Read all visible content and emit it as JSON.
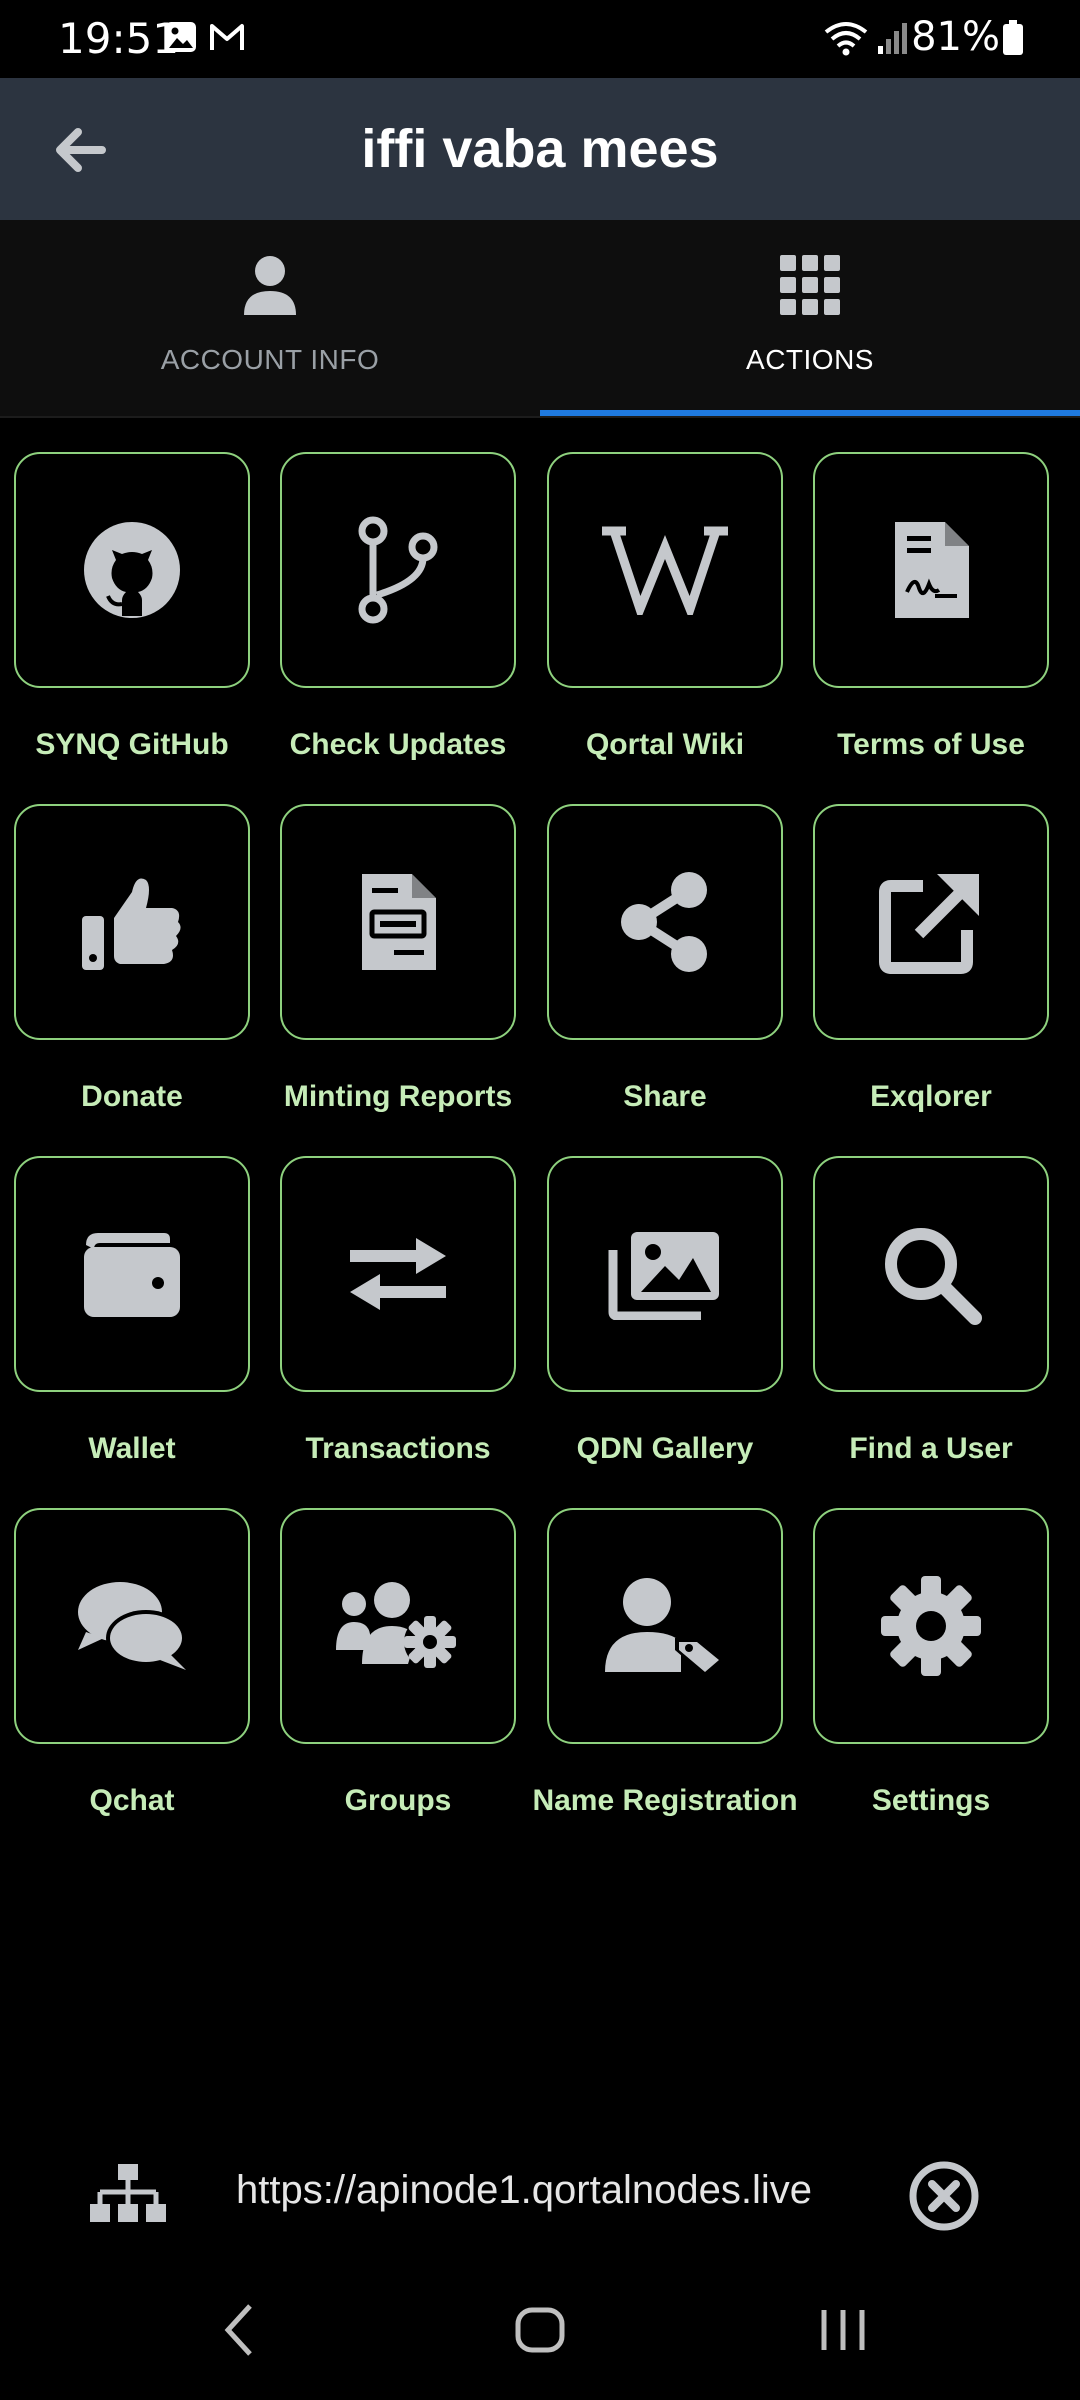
{
  "status_bar": {
    "time": "19:51",
    "battery": "81%"
  },
  "header": {
    "title": "iffi vaba mees",
    "back_icon": "arrow-left-icon"
  },
  "tabs": [
    {
      "label": "ACCOUNT INFO",
      "icon": "person-icon",
      "selected": false
    },
    {
      "label": "ACTIONS",
      "icon": "grid-icon",
      "selected": true
    }
  ],
  "actions": [
    {
      "label": "SYNQ GitHub",
      "icon": "github-icon"
    },
    {
      "label": "Check Updates",
      "icon": "git-branch-icon"
    },
    {
      "label": "Qortal Wiki",
      "icon": "wikipedia-icon"
    },
    {
      "label": "Terms of Use",
      "icon": "signed-document-icon"
    },
    {
      "label": "Donate",
      "icon": "thumbs-up-icon"
    },
    {
      "label": "Minting Reports",
      "icon": "report-document-icon"
    },
    {
      "label": "Share",
      "icon": "share-icon"
    },
    {
      "label": "Exqlorer",
      "icon": "external-link-icon"
    },
    {
      "label": "Wallet",
      "icon": "wallet-icon"
    },
    {
      "label": "Transactions",
      "icon": "swap-arrows-icon"
    },
    {
      "label": "QDN Gallery",
      "icon": "image-gallery-icon"
    },
    {
      "label": "Find a User",
      "icon": "search-icon"
    },
    {
      "label": "Qchat",
      "icon": "chat-bubbles-icon"
    },
    {
      "label": "Groups",
      "icon": "group-settings-icon"
    },
    {
      "label": "Name Registration",
      "icon": "user-tag-icon"
    },
    {
      "label": "Settings",
      "icon": "gear-icon"
    }
  ],
  "node": {
    "url": "https://apinode1.qortalnodes.live",
    "icon": "network-icon",
    "close_icon": "close-circle-icon"
  },
  "colors": {
    "accent_green": "#8ed17e",
    "label_green": "#c6ecb8",
    "tab_indicator": "#1f7ae0",
    "appbar_bg": "#2c3440",
    "icon_gray": "#c5c8cc"
  }
}
